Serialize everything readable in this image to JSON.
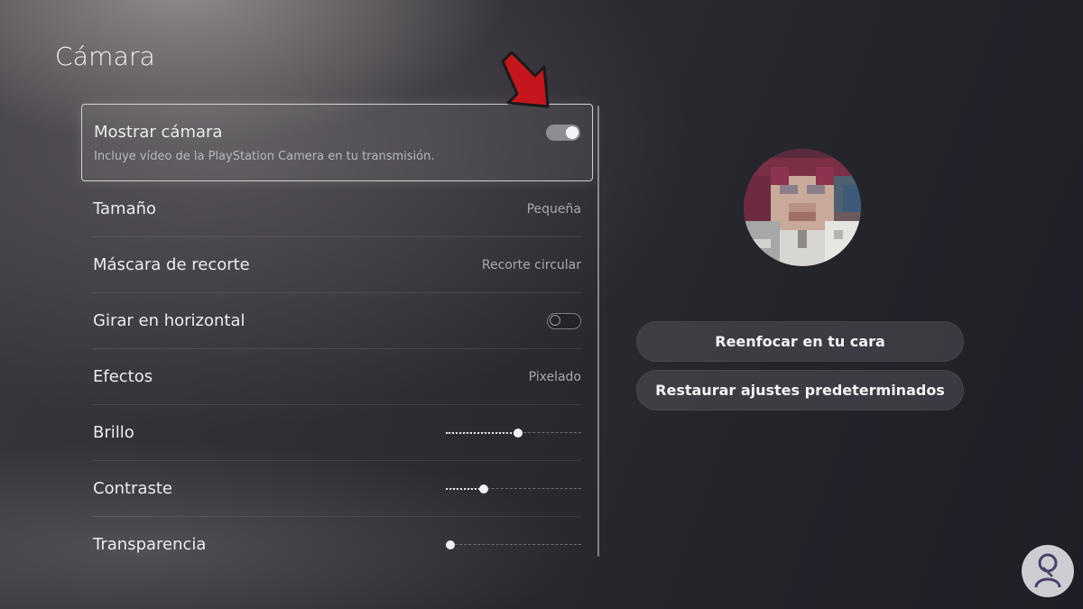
{
  "page": {
    "title": "Cámara"
  },
  "settings": {
    "show_camera": {
      "label": "Mostrar cámara",
      "description": "Incluye vídeo de la PlayStation Camera en tu transmisión.",
      "enabled": true
    },
    "size": {
      "label": "Tamaño",
      "value": "Pequeña"
    },
    "crop_mask": {
      "label": "Máscara de recorte",
      "value": "Recorte circular"
    },
    "flip_horizontal": {
      "label": "Girar en horizontal",
      "enabled": false
    },
    "effects": {
      "label": "Efectos",
      "value": "Pixelado"
    },
    "brightness": {
      "label": "Brillo",
      "level": 0.53
    },
    "contrast": {
      "label": "Contraste",
      "level": 0.28
    },
    "transparency": {
      "label": "Transparencia",
      "level": 0.03
    }
  },
  "actions": {
    "refocus_label": "Reenfocar en tu cara",
    "restore_label": "Restaurar ajustes predeterminados"
  },
  "colors": {
    "annotation_arrow": "#c4161c",
    "toggle_on": "#8e8d93"
  }
}
